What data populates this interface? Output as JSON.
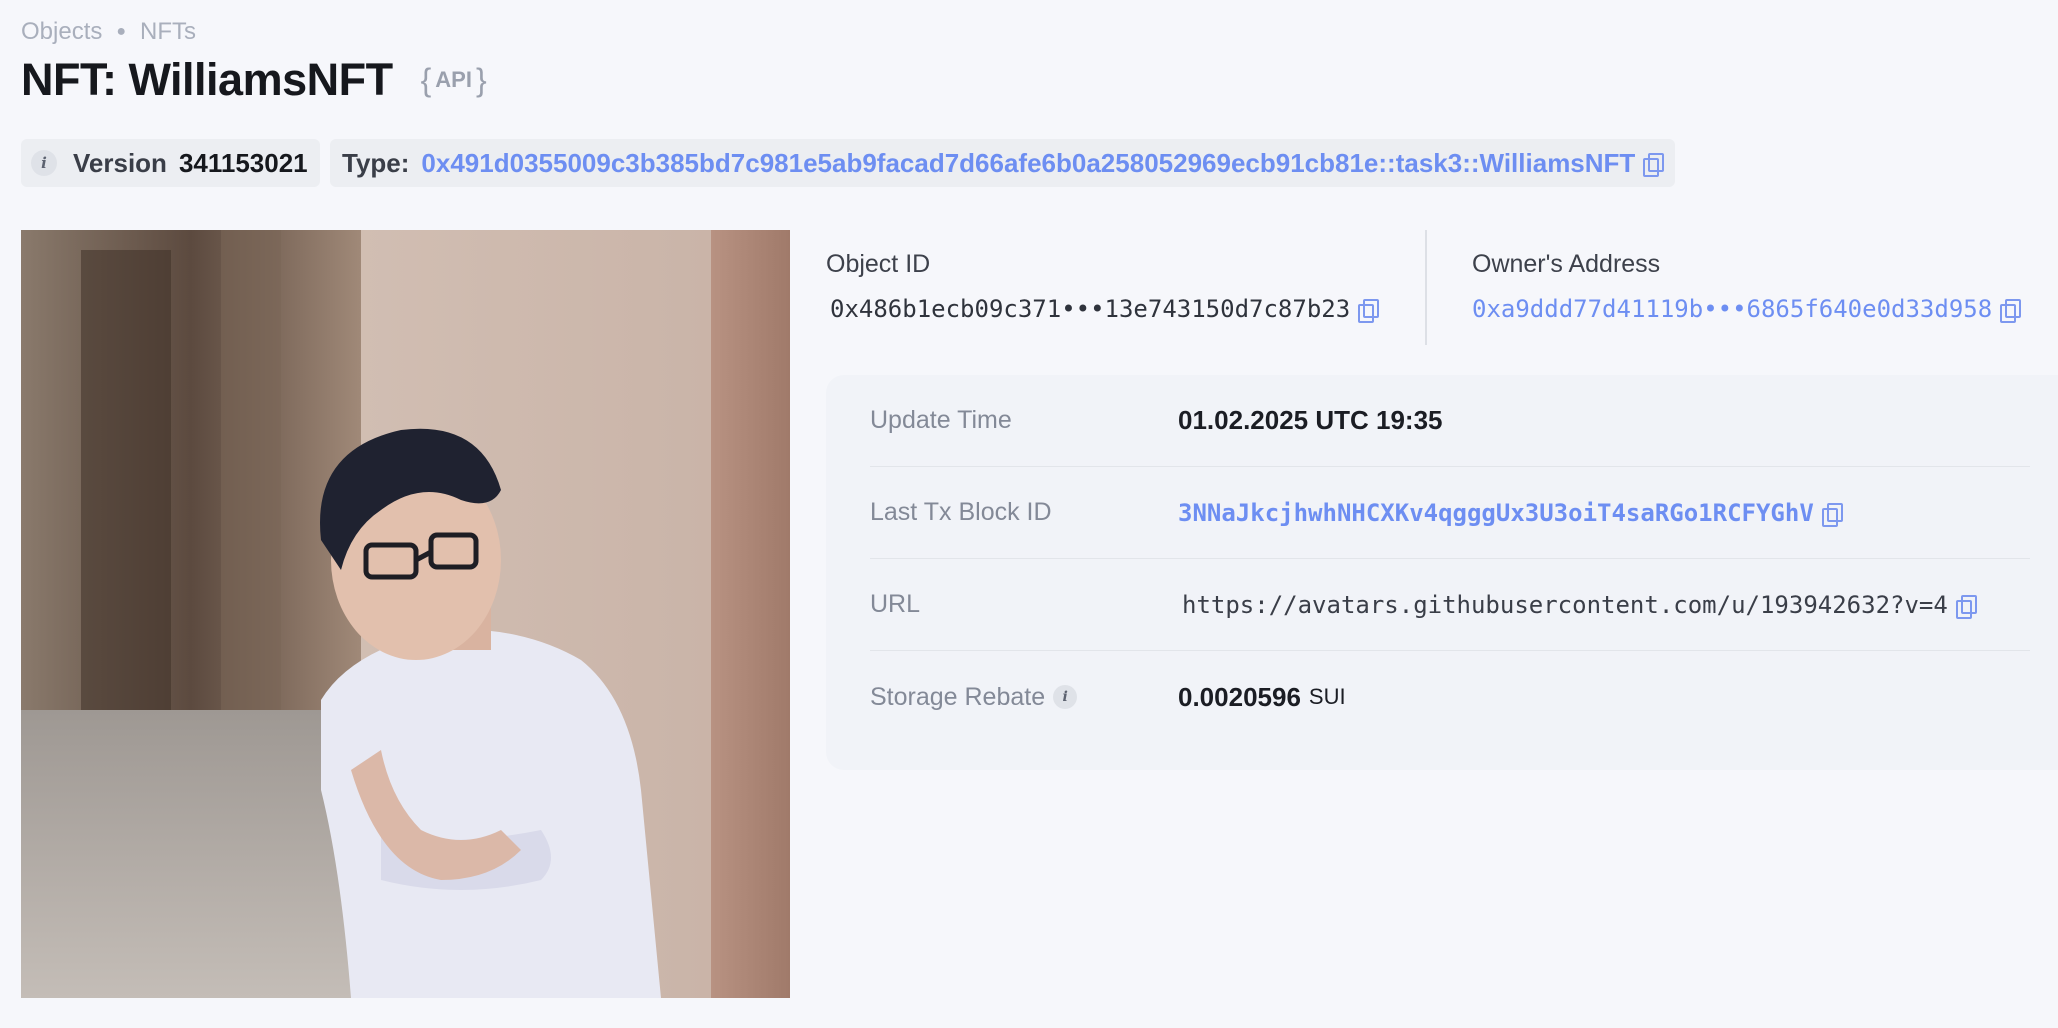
{
  "breadcrumb": {
    "items": [
      "Objects",
      "NFTs"
    ]
  },
  "header": {
    "title": "NFT: WilliamsNFT",
    "api_label": "API"
  },
  "chips": {
    "version_label": "Version",
    "version_value": "341153021",
    "type_label": "Type:",
    "type_value": "0x491d0355009c3b385bd7c981e5ab9facad7d66afe6b0a258052969ecb91cb81e::task3::WilliamsNFT"
  },
  "object": {
    "id_label": "Object ID",
    "id_value": "0x486b1ecb09c371•••13e743150d7c87b23",
    "owner_label": "Owner's Address",
    "owner_value": "0xa9ddd77d41119b•••6865f640e0d33d958"
  },
  "details": {
    "update_time_label": "Update Time",
    "update_time_value": "01.02.2025 UTC 19:35",
    "last_tx_label": "Last Tx Block ID",
    "last_tx_value": "3NNaJkcjhwhNHCXKv4qgggUx3U3oiT4saRGo1RCFYGhV",
    "url_label": "URL",
    "url_value": "https://avatars.githubusercontent.com/u/193942632?v=4",
    "rebate_label": "Storage Rebate",
    "rebate_value": "0.0020596",
    "rebate_unit": "SUI"
  },
  "icons": {
    "info": "info-icon",
    "copy": "copy-icon",
    "link_color": "#6d8ef2"
  }
}
